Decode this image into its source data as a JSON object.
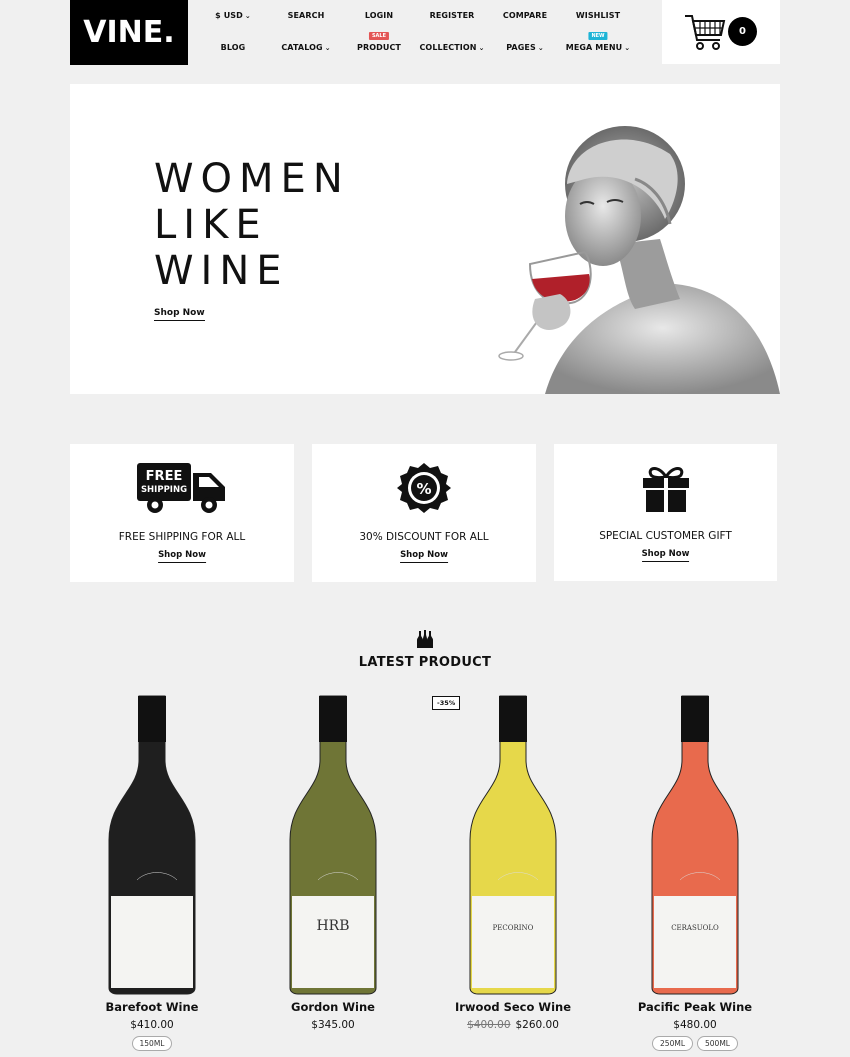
{
  "logo": "VINE.",
  "nav": {
    "top": [
      {
        "label": "$ USD",
        "dropdown": true
      },
      {
        "label": "SEARCH",
        "dropdown": false
      },
      {
        "label": "LOGIN",
        "dropdown": false
      },
      {
        "label": "REGISTER",
        "dropdown": false
      },
      {
        "label": "COMPARE",
        "dropdown": false
      },
      {
        "label": "WISHLIST",
        "dropdown": false
      }
    ],
    "bottom": [
      {
        "label": "BLOG",
        "dropdown": false
      },
      {
        "label": "CATALOG",
        "dropdown": true
      },
      {
        "label": "PRODUCT",
        "dropdown": false,
        "badge": "SALE"
      },
      {
        "label": "COLLECTION",
        "dropdown": true
      },
      {
        "label": "PAGES",
        "dropdown": true
      },
      {
        "label": "MEGA MENU",
        "dropdown": true,
        "badge": "NEW"
      }
    ],
    "chevron": "⌄"
  },
  "cart": {
    "count": "0",
    "icon": "cart-icon"
  },
  "hero": {
    "title_lines": [
      "WOMEN",
      "LIKE",
      "WINE"
    ],
    "cta": "Shop Now"
  },
  "features": [
    {
      "title": "FREE SHIPPING FOR ALL",
      "cta": "Shop Now",
      "icon": "truck-icon",
      "icon_text": [
        "FREE",
        "SHIPPING"
      ]
    },
    {
      "title": "30% DISCOUNT FOR ALL",
      "cta": "Shop Now",
      "icon": "discount-badge-icon",
      "icon_text": [
        "%"
      ]
    },
    {
      "title": "SPECIAL CUSTOMER GIFT",
      "cta": "Shop Now",
      "icon": "gift-icon"
    }
  ],
  "latest": {
    "title": "LATEST PRODUCT",
    "icon": "wine-bottles-icon",
    "discount_badge": "-35%",
    "products": [
      {
        "name": "Barefoot Wine",
        "price": "$410.00",
        "old_price": "",
        "sizes": [
          "150ML"
        ],
        "wine_color": "#1f1f1f",
        "label": ""
      },
      {
        "name": "Gordon Wine",
        "price": "$345.00",
        "old_price": "",
        "sizes": [],
        "wine_color": "#6f7536",
        "label": "HRB"
      },
      {
        "name": "Irwood Seco Wine",
        "price": "$260.00",
        "old_price": "$400.00",
        "sizes": [],
        "wine_color": "#e6d84a",
        "label": "PECORINO"
      },
      {
        "name": "Pacific Peak Wine",
        "price": "$480.00",
        "old_price": "",
        "sizes": [
          "250ML",
          "500ML"
        ],
        "wine_color": "#e86a4d",
        "label": "CERASUOLO"
      }
    ]
  },
  "colors": {
    "sale": "#e35555",
    "new": "#1eb4d6",
    "accent": "#000000"
  }
}
